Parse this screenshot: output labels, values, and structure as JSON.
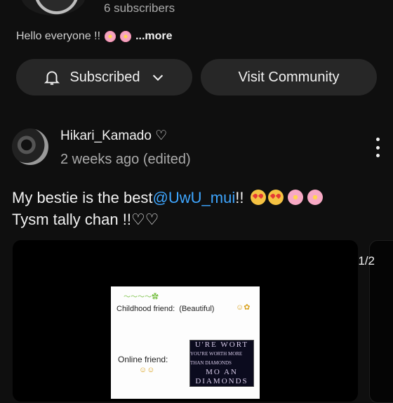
{
  "channel": {
    "subscribers": "6 subscribers",
    "description": "Hello everyone !!",
    "more": "...more"
  },
  "buttons": {
    "subscribed": "Subscribed",
    "visit": "Visit Community"
  },
  "post": {
    "author": "Hikari_Kamado ♡",
    "time": "2 weeks ago (edited)",
    "text_before": "My bestie is the best",
    "mention": "@UwU_mui",
    "text_after": "!!",
    "line2": "Tysm tally chan !!♡♡",
    "counter": "1/2"
  },
  "image": {
    "childhood": "Childhood friend:",
    "beautiful": "(Beautiful)",
    "online": "Online friend:",
    "dark1": "U'RE WORT",
    "dark_small": "YOU'RE WORTH MORE THAN DIAMONDS",
    "dark2": "MO    AN",
    "dark3": "DIAMONDS"
  },
  "colors": {
    "background": "#0f0f0f",
    "button": "#272727",
    "mention": "#3ea6ff",
    "secondary_text": "#aaaaaa"
  },
  "icons": [
    "bell-icon",
    "chevron-down-icon",
    "more-vert-icon"
  ]
}
